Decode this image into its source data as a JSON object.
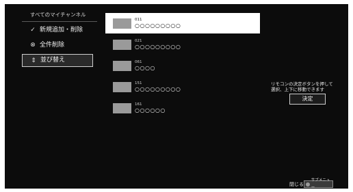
{
  "sidebar": {
    "title": "すべてのマイチャンネル",
    "items": [
      {
        "icon": "checkmark-icon",
        "glyph": "✓",
        "label": "新規追加・削除"
      },
      {
        "icon": "clear-circle-icon",
        "glyph": "⊗",
        "label": "全件削除"
      },
      {
        "icon": "sort-arrows-icon",
        "glyph": "⇕",
        "label": "並び替え",
        "selected": true
      }
    ]
  },
  "channels": [
    {
      "number": "011",
      "name": "○○○○○○○○○",
      "focused": true
    },
    {
      "number": "021",
      "name": "○○○○○○○○○"
    },
    {
      "number": "061",
      "name": "○○○○"
    },
    {
      "number": "151",
      "name": "○○○○○○○○○"
    },
    {
      "number": "161",
      "name": "○○○○○○"
    }
  ],
  "hint": {
    "line1": "リモコンの決定ボタンを押して",
    "line2": "選択、上下に移動できます"
  },
  "confirm_button": "決定",
  "footer": {
    "close_label": "閉じる",
    "submenu_label": "サブメニュー"
  }
}
